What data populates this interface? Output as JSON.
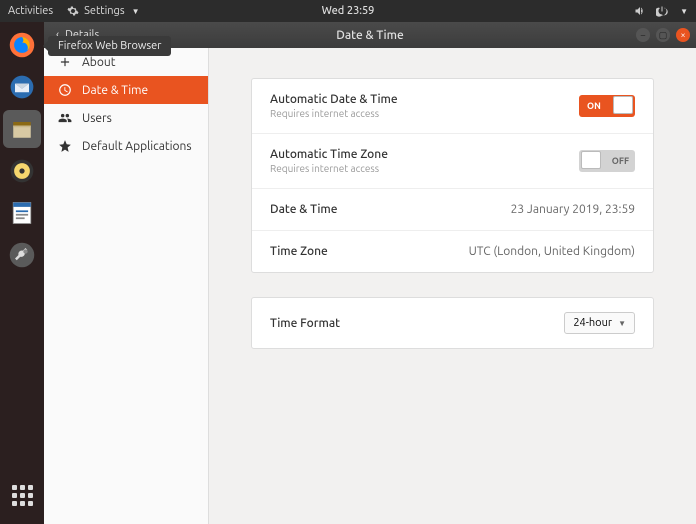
{
  "topbar": {
    "activities": "Activities",
    "app_name": "Settings",
    "clock": "Wed 23:59"
  },
  "tooltip": "Firefox Web Browser",
  "window": {
    "back_label": "Details",
    "title": "Date & Time"
  },
  "sidebar": {
    "items": [
      {
        "label": "About"
      },
      {
        "label": "Date & Time"
      },
      {
        "label": "Users"
      },
      {
        "label": "Default Applications"
      }
    ]
  },
  "content": {
    "auto_dt": {
      "label": "Automatic Date & Time",
      "sub": "Requires internet access",
      "switch": "ON"
    },
    "auto_tz": {
      "label": "Automatic Time Zone",
      "sub": "Requires internet access",
      "switch": "OFF"
    },
    "dt": {
      "label": "Date & Time",
      "value": "23 January 2019, 23:59"
    },
    "tz": {
      "label": "Time Zone",
      "value": "UTC (London, United Kingdom)"
    },
    "fmt": {
      "label": "Time Format",
      "value": "24-hour"
    }
  }
}
